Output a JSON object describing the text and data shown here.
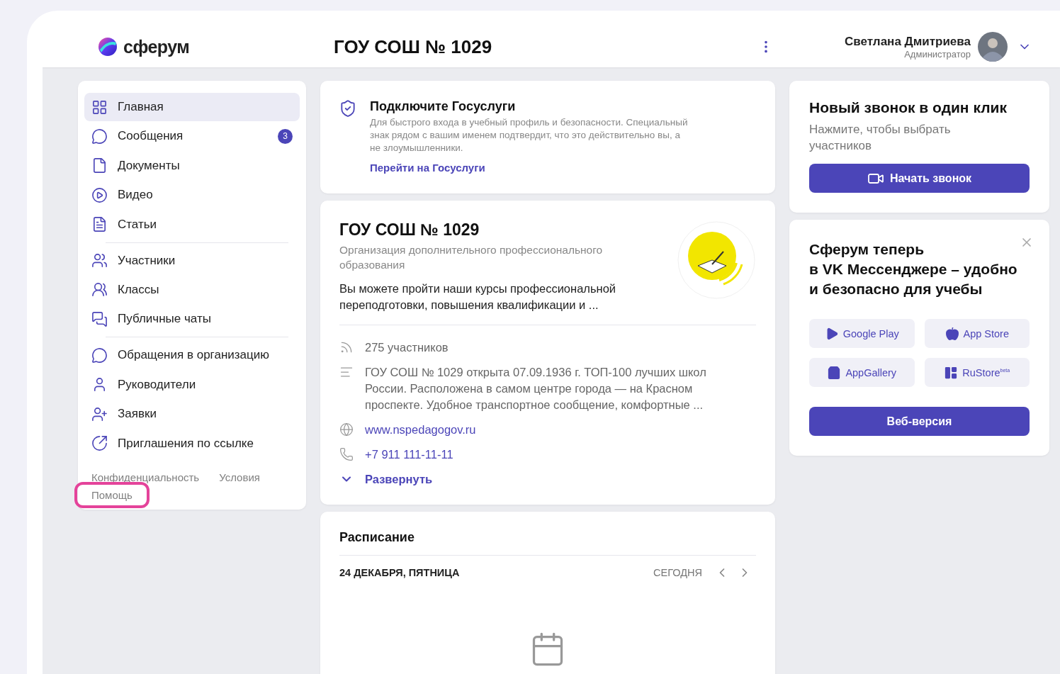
{
  "header": {
    "logo_text": "сферум",
    "org_title": "ГОУ СОШ № 1029",
    "user": {
      "name": "Светлана Дмитриева",
      "role": "Администратор"
    }
  },
  "nav_groups": [
    {
      "items": [
        {
          "label": "Главная",
          "selected": true
        },
        {
          "label": "Сообщения",
          "selected": false,
          "badge": "3"
        },
        {
          "label": "Документы",
          "selected": false
        },
        {
          "label": "Видео",
          "selected": false
        },
        {
          "label": "Статьи",
          "selected": false
        }
      ]
    },
    {
      "items": [
        {
          "label": "Участники",
          "selected": false
        },
        {
          "label": "Классы",
          "selected": false
        },
        {
          "label": "Публичные чаты",
          "selected": false
        }
      ]
    },
    {
      "items": [
        {
          "label": "Обращения в организацию",
          "selected": false
        },
        {
          "label": "Руководители",
          "selected": false
        },
        {
          "label": "Заявки",
          "selected": false
        },
        {
          "label": "Приглашения по ссылке",
          "selected": false
        }
      ]
    }
  ],
  "footer_links": [
    {
      "label": "Конфиденциальность",
      "highlighted": false
    },
    {
      "label": "Условия",
      "highlighted": false
    },
    {
      "label": "Помощь",
      "highlighted": true
    }
  ],
  "gosuslugi": {
    "title": "Подключите Госуслуги",
    "text": "Для быстрого входа в учебный профиль и безопасности. Специальный знак рядом с вашим именем подтвердит, что это действительно вы, а не злоумышленники.",
    "link": "Перейти на Госуслуги"
  },
  "org_card": {
    "title": "ГОУ СОШ № 1029",
    "subtitle": "Организация дополнительного профессионального образования",
    "description": "Вы можете пройти наши курсы профессиональной переподготовки, повышения квалификации и ...",
    "details": [
      {
        "kind": "members",
        "text": "275 участников"
      },
      {
        "kind": "about",
        "text": "ГОУ СОШ № 1029 открыта 07.09.1936 г. ТОП-100 лучших школ России. Расположена в самом центре города — на Красном проспекте. Удобное транспортное сообщение, комфортные ..."
      },
      {
        "kind": "site",
        "text": "www.nspedagogov.ru"
      },
      {
        "kind": "phone",
        "text": "+7 911 111-11-11"
      },
      {
        "kind": "expand",
        "text": "Развернуть"
      }
    ]
  },
  "schedule": {
    "title": "Расписание",
    "date": "24 ДЕКАБРЯ, ПЯТНИЦА",
    "today": "СЕГОДНЯ"
  },
  "call_card": {
    "title": "Новый звонок в один клик",
    "text": "Нажмите, чтобы выбрать участников",
    "button": "Начать звонок"
  },
  "promo_card": {
    "title": "Сферум теперь\nв VK Мессенджере – удобно\nи безопасно для учебы",
    "stores": [
      {
        "kind": "google",
        "label": "Google Play"
      },
      {
        "kind": "apple",
        "label": "App Store"
      },
      {
        "kind": "gallery",
        "label": "AppGallery"
      },
      {
        "kind": "rustore",
        "label": "RuStore$^{beta}$"
      }
    ],
    "button": "Веб-версия"
  }
}
